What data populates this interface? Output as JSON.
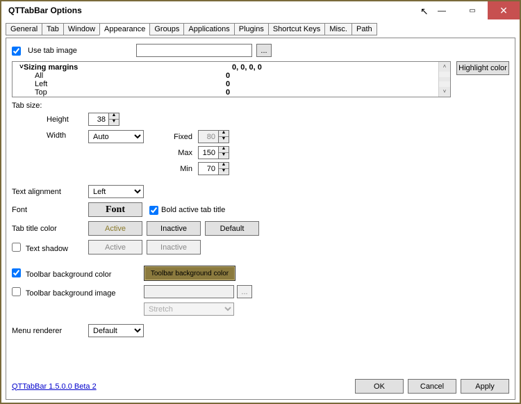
{
  "window": {
    "title": "QTTabBar Options"
  },
  "tabs": [
    "General",
    "Tab",
    "Window",
    "Appearance",
    "Groups",
    "Applications",
    "Plugins",
    "Shortcut Keys",
    "Misc.",
    "Path"
  ],
  "activeTab": "Appearance",
  "useTabImage": {
    "label": "Use tab image",
    "checked": true,
    "path": "",
    "browse": "..."
  },
  "highlightColor": "Highlight color",
  "marginsHeader": {
    "name": "Sizing margins",
    "value": "0, 0, 0, 0"
  },
  "marginsRows": [
    {
      "name": "All",
      "value": "0"
    },
    {
      "name": "Left",
      "value": "0"
    },
    {
      "name": "Top",
      "value": "0"
    }
  ],
  "tabSize": {
    "label": "Tab size:",
    "heightLabel": "Height",
    "heightValue": "38",
    "widthLabel": "Width",
    "widthValue": "Auto",
    "fixedLabel": "Fixed",
    "fixedValue": "80",
    "maxLabel": "Max",
    "maxValue": "150",
    "minLabel": "Min",
    "minValue": "70"
  },
  "textAlign": {
    "label": "Text alignment",
    "value": "Left"
  },
  "font": {
    "label": "Font",
    "button": "Font",
    "boldLabel": "Bold active tab title",
    "boldChecked": true
  },
  "tabTitleColor": {
    "label": "Tab title color",
    "active": "Active",
    "inactive": "Inactive",
    "default": "Default"
  },
  "textShadow": {
    "label": "Text shadow",
    "checked": false,
    "active": "Active",
    "inactive": "Inactive"
  },
  "toolbarBgColor": {
    "label": "Toolbar background color",
    "checked": true,
    "swatch": "Toolbar background color"
  },
  "toolbarBgImage": {
    "label": "Toolbar background image",
    "checked": false,
    "path": "",
    "browse": "...",
    "mode": "Stretch"
  },
  "menuRenderer": {
    "label": "Menu renderer",
    "value": "Default"
  },
  "footer": {
    "link": "QTTabBar 1.5.0.0 Beta 2",
    "ok": "OK",
    "cancel": "Cancel",
    "apply": "Apply"
  }
}
